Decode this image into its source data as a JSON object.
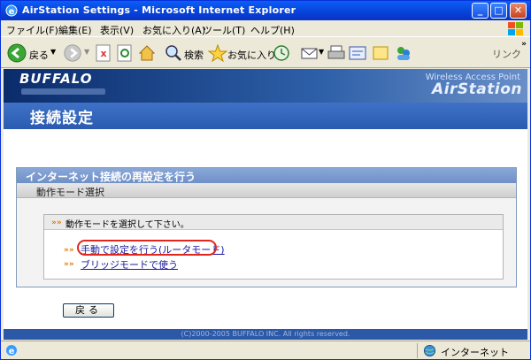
{
  "window": {
    "title": "AirStation Settings - Microsoft Internet Explorer"
  },
  "menubar": {
    "items": [
      "ファイル(F)",
      "編集(E)",
      "表示(V)",
      "お気に入り(A)",
      "ツール(T)",
      "ヘルプ(H)"
    ]
  },
  "toolbar": {
    "back": "戻る",
    "search": "検索",
    "favorites": "お気に入り",
    "links": "リンク"
  },
  "header": {
    "brand": "BUFFALO",
    "product_line1": "Wireless Access Point",
    "product_line2": "AirStation",
    "page_title": "接続設定"
  },
  "panel": {
    "title": "インターネット接続の再設定を行う",
    "subtitle": "動作モード選択",
    "instruction": "動作モードを選択して下さい。",
    "options": [
      "手動で設定を行う(ルータモード)",
      "ブリッジモードで使う"
    ]
  },
  "back_button": "戻る",
  "footer": "(C)2000-2005 BUFFALO INC. All rights reserved.",
  "statusbar": {
    "zone": "インターネット"
  },
  "colors": {
    "accent": "#2a5bb0",
    "highlight": "#e0261d",
    "link": "#1a1aa0"
  }
}
